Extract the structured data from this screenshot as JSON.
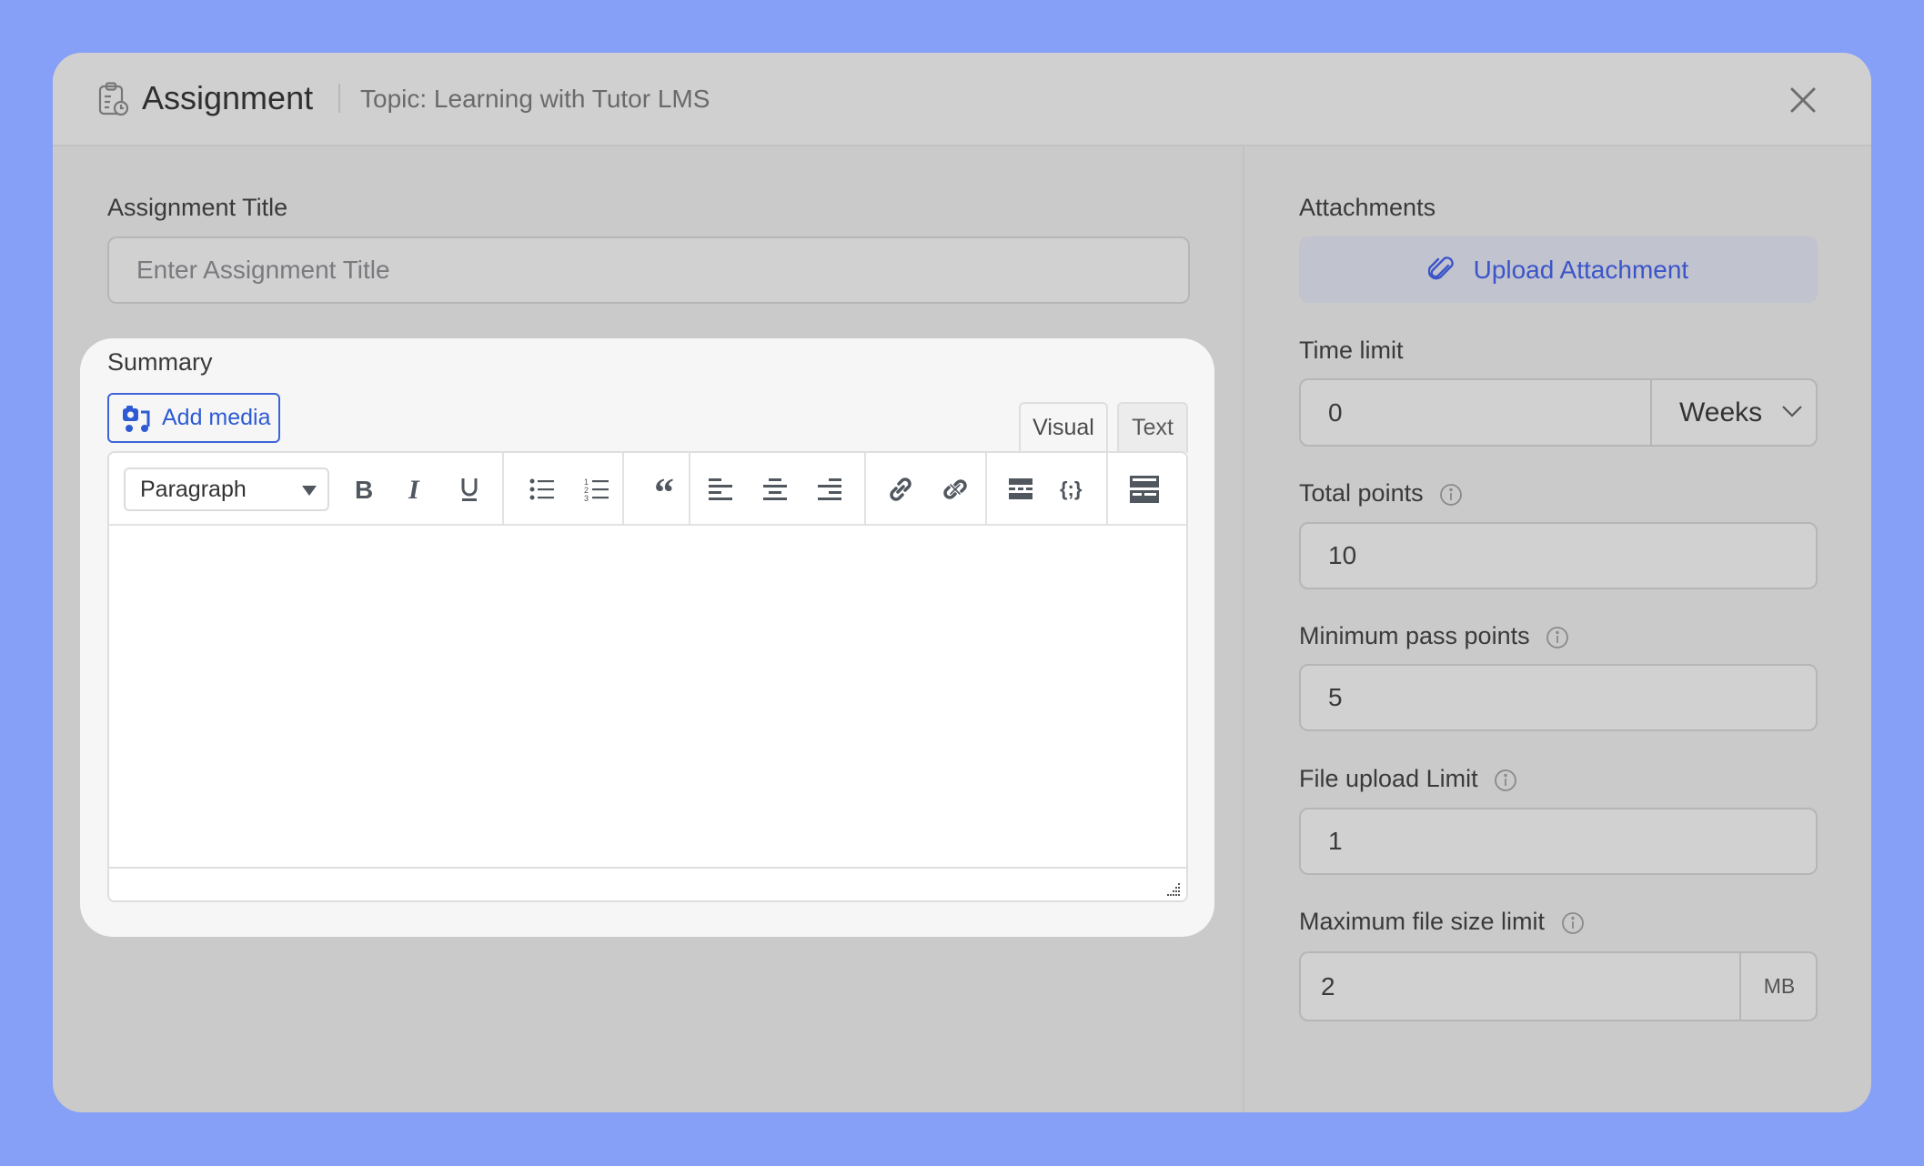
{
  "header": {
    "title": "Assignment",
    "topic": "Topic: Learning with Tutor LMS",
    "icon": "clipboard-clock-icon",
    "close_icon": "close-icon"
  },
  "left": {
    "title_label": "Assignment Title",
    "title_placeholder": "Enter Assignment Title",
    "title_value": "",
    "summary": {
      "label": "Summary",
      "add_media_label": "Add media",
      "tabs": [
        {
          "label": "Visual",
          "active": true
        },
        {
          "label": "Text",
          "active": false
        }
      ],
      "format_select": "Paragraph",
      "toolbar_buttons": [
        "bold",
        "italic",
        "underline",
        "bulleted-list",
        "numbered-list",
        "blockquote",
        "align-left",
        "align-center",
        "align-right",
        "insert-link",
        "remove-link",
        "read-more",
        "code-block",
        "toolbar-toggle"
      ],
      "content": ""
    }
  },
  "right": {
    "attachments_label": "Attachments",
    "upload_label": "Upload Attachment",
    "time_limit": {
      "label": "Time limit",
      "value": "0",
      "unit": "Weeks"
    },
    "total_points": {
      "label": "Total points",
      "value": "10"
    },
    "min_pass_points": {
      "label": "Minimum pass points",
      "value": "5"
    },
    "file_upload_limit": {
      "label": "File upload Limit",
      "value": "1"
    },
    "max_file_size": {
      "label": "Maximum file size limit",
      "value": "2",
      "unit": "MB"
    }
  },
  "colors": {
    "background": "#86a0f7",
    "accent": "#2e5bd3",
    "upload_bg": "#c1c3cf"
  }
}
